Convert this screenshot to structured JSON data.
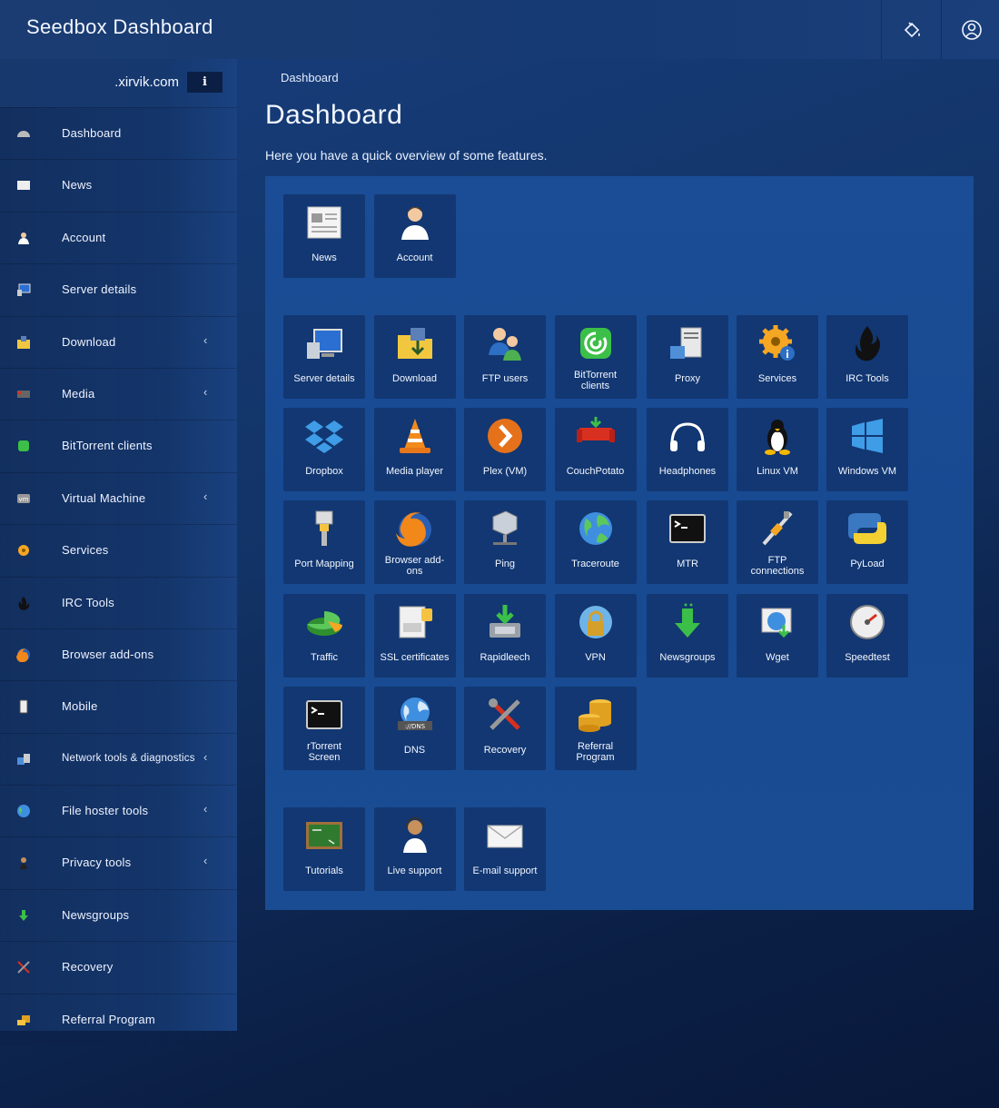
{
  "app": {
    "title": "Seedbox Dashboard"
  },
  "sidebar": {
    "domain": ".xirvik.com",
    "info_glyph": "i",
    "items": [
      {
        "label": "Dashboard",
        "icon": "dashboard-icon",
        "has_submenu": false
      },
      {
        "label": "News",
        "icon": "news-icon",
        "has_submenu": false
      },
      {
        "label": "Account",
        "icon": "account-icon",
        "has_submenu": false
      },
      {
        "label": "Server details",
        "icon": "server-details-icon",
        "has_submenu": false
      },
      {
        "label": "Download",
        "icon": "download-icon",
        "has_submenu": true
      },
      {
        "label": "Media",
        "icon": "media-icon",
        "has_submenu": true
      },
      {
        "label": "BitTorrent clients",
        "icon": "bittorrent-icon",
        "has_submenu": false
      },
      {
        "label": "Virtual Machine",
        "icon": "vm-icon",
        "has_submenu": true
      },
      {
        "label": "Services",
        "icon": "services-icon",
        "has_submenu": false
      },
      {
        "label": "IRC Tools",
        "icon": "irc-icon",
        "has_submenu": false
      },
      {
        "label": "Browser add-ons",
        "icon": "firefox-icon",
        "has_submenu": false
      },
      {
        "label": "Mobile",
        "icon": "mobile-icon",
        "has_submenu": false
      },
      {
        "label": "Network tools & diagnostics",
        "icon": "network-icon",
        "has_submenu": true
      },
      {
        "label": "File hoster tools",
        "icon": "globe-icon",
        "has_submenu": true
      },
      {
        "label": "Privacy tools",
        "icon": "privacy-icon",
        "has_submenu": true
      },
      {
        "label": "Newsgroups",
        "icon": "newsgroups-icon",
        "has_submenu": false
      },
      {
        "label": "Recovery",
        "icon": "recovery-icon",
        "has_submenu": false
      },
      {
        "label": "Referral Program",
        "icon": "referral-icon",
        "has_submenu": false
      }
    ]
  },
  "main": {
    "breadcrumb": "Dashboard",
    "title": "Dashboard",
    "intro": "Here you have a quick overview of some features."
  },
  "tiles": [
    {
      "label": "News",
      "icon": "newspaper-icon"
    },
    {
      "label": "Account",
      "icon": "account-icon"
    },
    {
      "label": "Server details",
      "icon": "server-details-icon"
    },
    {
      "label": "Download",
      "icon": "download-folder-icon"
    },
    {
      "label": "FTP users",
      "icon": "ftp-users-icon"
    },
    {
      "label": "BitTorrent clients",
      "icon": "bittorrent-icon"
    },
    {
      "label": "Proxy",
      "icon": "proxy-icon"
    },
    {
      "label": "Services",
      "icon": "services-gear-icon"
    },
    {
      "label": "IRC Tools",
      "icon": "irc-flame-icon"
    },
    {
      "label": "Dropbox",
      "icon": "dropbox-icon"
    },
    {
      "label": "Media player",
      "icon": "vlc-cone-icon"
    },
    {
      "label": "Plex (VM)",
      "icon": "plex-icon"
    },
    {
      "label": "CouchPotato",
      "icon": "couchpotato-icon"
    },
    {
      "label": "Headphones",
      "icon": "headphones-icon"
    },
    {
      "label": "Linux VM",
      "icon": "linux-tux-icon"
    },
    {
      "label": "Windows VM",
      "icon": "windows-icon"
    },
    {
      "label": "Port Mapping",
      "icon": "port-connector-icon"
    },
    {
      "label": "Browser add-ons",
      "icon": "firefox-icon"
    },
    {
      "label": "Ping",
      "icon": "ping-icon"
    },
    {
      "label": "Traceroute",
      "icon": "globe-icon"
    },
    {
      "label": "MTR",
      "icon": "terminal-icon"
    },
    {
      "label": "FTP connections",
      "icon": "ftp-cable-icon"
    },
    {
      "label": "PyLoad",
      "icon": "python-icon"
    },
    {
      "label": "Traffic",
      "icon": "pie-chart-icon"
    },
    {
      "label": "SSL certificates",
      "icon": "ssl-certificate-icon"
    },
    {
      "label": "Rapidleech",
      "icon": "rapidleech-icon"
    },
    {
      "label": "VPN",
      "icon": "vpn-lock-icon"
    },
    {
      "label": "Newsgroups",
      "icon": "newsgroups-arrow-icon"
    },
    {
      "label": "Wget",
      "icon": "wget-icon"
    },
    {
      "label": "Speedtest",
      "icon": "speedometer-icon"
    },
    {
      "label": "rTorrent Screen",
      "icon": "terminal-icon"
    },
    {
      "label": "DNS",
      "icon": "dns-globe-icon"
    },
    {
      "label": "Recovery",
      "icon": "recovery-tools-icon"
    },
    {
      "label": "Referral Program",
      "icon": "coins-icon"
    },
    {
      "label": "Tutorials",
      "icon": "chalkboard-icon"
    },
    {
      "label": "Live support",
      "icon": "live-support-icon"
    },
    {
      "label": "E-mail support",
      "icon": "email-envelope-icon"
    }
  ]
}
